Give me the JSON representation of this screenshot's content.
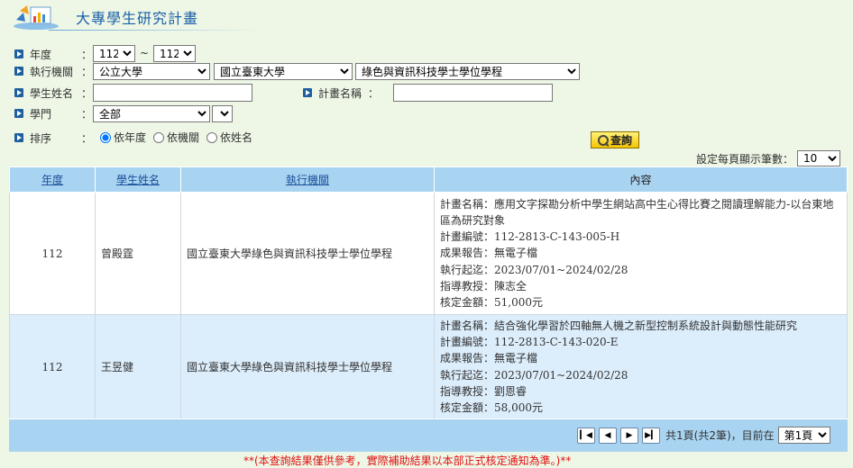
{
  "header": {
    "title": "大專學生研究計畫"
  },
  "filters": {
    "year": {
      "label": "年度",
      "from": "112",
      "separator": "~",
      "to": "112"
    },
    "org": {
      "label": "執行機關",
      "type": "公立大學",
      "school": "國立臺東大學",
      "dept": "綠色與資訊科技學士學位學程"
    },
    "student": {
      "label": "學生姓名",
      "value": ""
    },
    "plan": {
      "label": "計畫名稱",
      "value": ""
    },
    "field": {
      "label": "學門",
      "value": "全部",
      "sub": ""
    },
    "sort": {
      "label": "排序",
      "options": [
        "依年度",
        "依機關",
        "依姓名"
      ],
      "selected": "依年度"
    },
    "colon": "：",
    "query_label": "查詢"
  },
  "perpage": {
    "label": "設定每頁顯示筆數：",
    "value": "10"
  },
  "table": {
    "headers": {
      "year": "年度",
      "name": "學生姓名",
      "org": "執行機關",
      "content": "內容"
    },
    "rows": [
      {
        "year": "112",
        "name": "曾殿霆",
        "org": "國立臺東大學綠色與資訊科技學士學位學程",
        "plan_title_label": "計畫名稱：",
        "plan_title": "應用文字探勘分析中學生網站高中生心得比賽之閱讀理解能力-以台東地區為研究對象",
        "plan_no_label": "計畫編號：",
        "plan_no": "112-2813-C-143-005-H",
        "report_label": "成果報告：",
        "report": "無電子檔",
        "period_label": "執行起迄：",
        "period": "2023/07/01~2024/02/28",
        "advisor_label": "指導教授：",
        "advisor": "陳志全",
        "amount_label": "核定金額：",
        "amount": "51,000元"
      },
      {
        "year": "112",
        "name": "王昱健",
        "org": "國立臺東大學綠色與資訊科技學士學位學程",
        "plan_title_label": "計畫名稱：",
        "plan_title": "結合強化學習於四軸無人機之新型控制系統設計與動態性能研究",
        "plan_no_label": "計畫編號：",
        "plan_no": "112-2813-C-143-020-E",
        "report_label": "成果報告：",
        "report": "無電子檔",
        "period_label": "執行起迄：",
        "period": "2023/07/01~2024/02/28",
        "advisor_label": "指導教授：",
        "advisor": "劉恩睿",
        "amount_label": "核定金額：",
        "amount": "58,000元"
      }
    ]
  },
  "pager": {
    "info": "共1頁(共2筆)，目前在",
    "page": "第1頁"
  },
  "footnote": "**(本查詢結果僅供參考，實際補助結果以本部正式核定通知為準。)**"
}
